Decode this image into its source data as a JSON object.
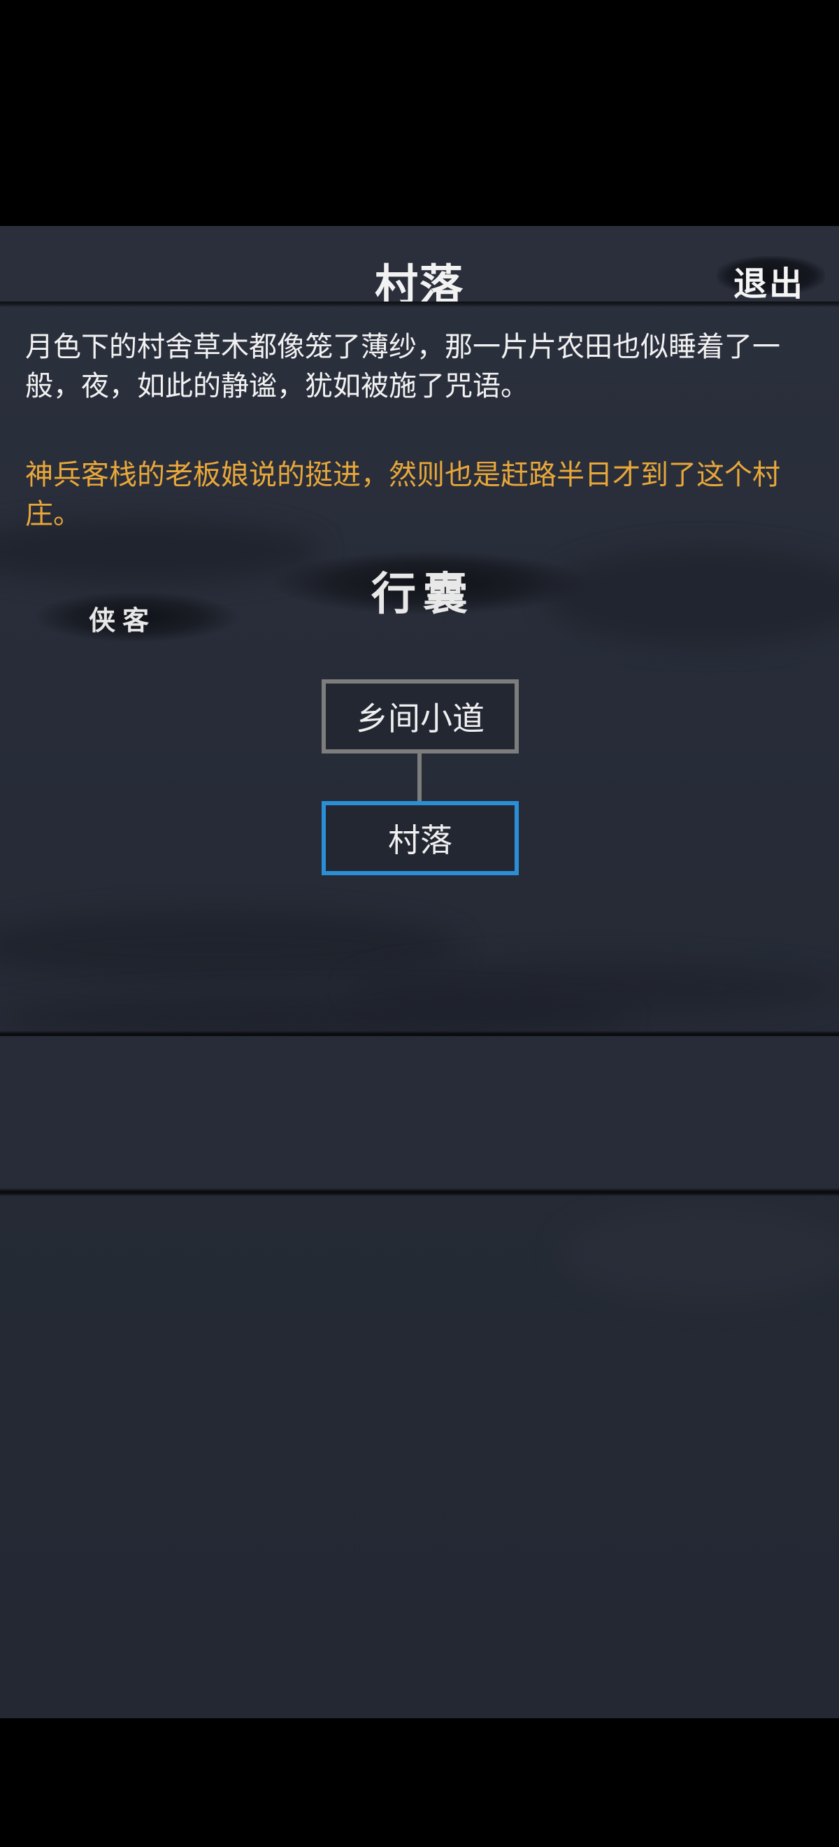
{
  "header": {
    "title": "村落",
    "exit_label": "退出"
  },
  "story": {
    "description": "月色下的村舍草木都像笼了薄纱，那一片片农田也似睡着了一般，夜，如此的静谧，犹如被施了咒语。",
    "highlight": "神兵客栈的老板娘说的挺进，然则也是赶路半日才到了这个村庄。"
  },
  "menu": {
    "bag_label": "行囊",
    "hero_label": "侠客"
  },
  "map": {
    "previous_node": "乡间小道",
    "current_node": "村落"
  },
  "colors": {
    "highlight_text": "#e8a73a",
    "current_node_border": "#2a8fd6",
    "previous_node_border": "#7d7d7d"
  }
}
